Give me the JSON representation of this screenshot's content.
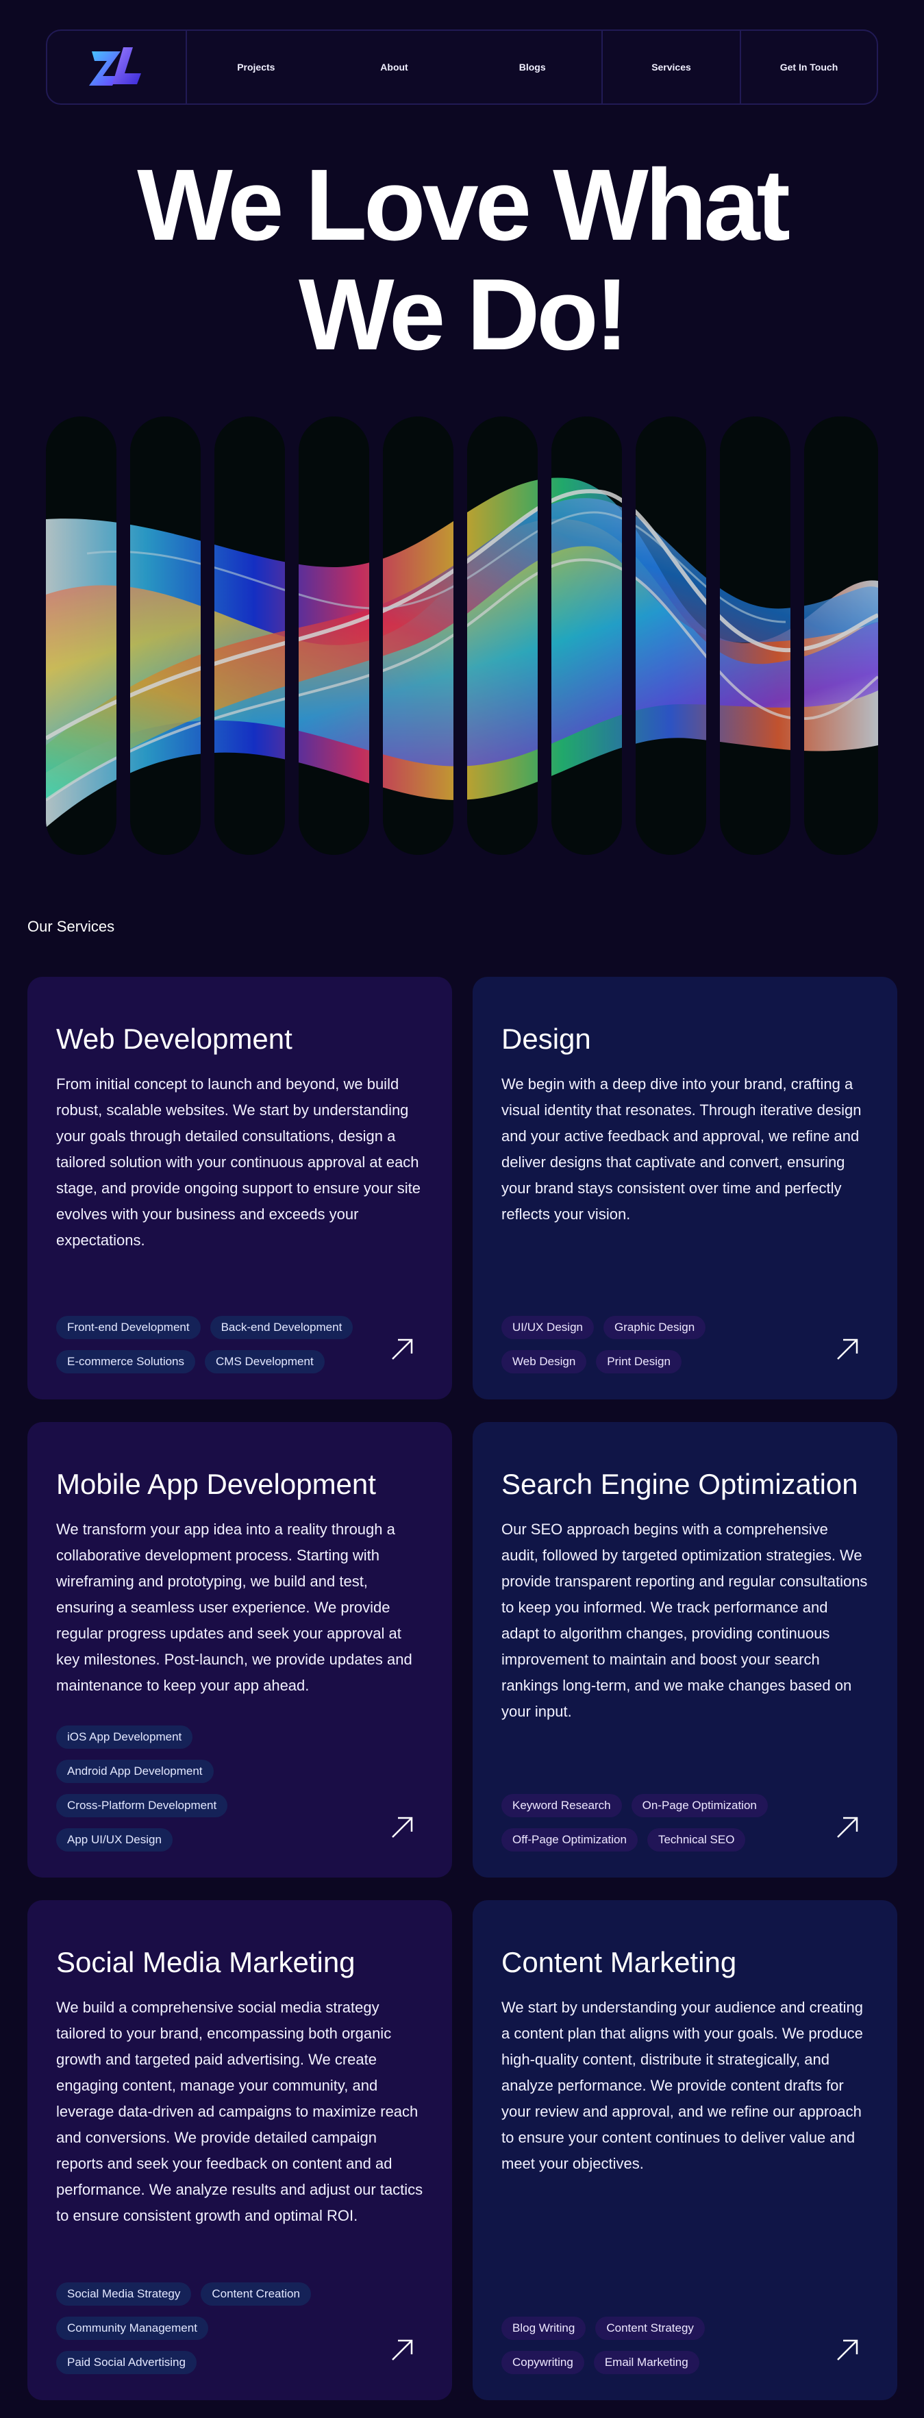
{
  "nav": {
    "logo_icon": "zl-logo-icon",
    "links": [
      "Projects",
      "About",
      "Blogs"
    ],
    "services_label": "Services",
    "contact_label": "Get In Touch"
  },
  "hero": {
    "line1": "We Love What",
    "line2": "We Do!"
  },
  "services": {
    "label": "Our Services",
    "cards": [
      {
        "title": "Web Development",
        "body": "From initial concept to launch and beyond, we build robust, scalable websites. We start by understanding your goals through detailed consultations, design a tailored solution with your continuous approval at each stage, and provide ongoing support to ensure your site evolves with your business and exceeds your expectations.",
        "tags": [
          "Front-end Development",
          "Back-end Development",
          "E-commerce Solutions",
          "CMS Development"
        ]
      },
      {
        "title": "Design",
        "body": "We begin with a deep dive into your brand, crafting a visual identity that resonates. Through iterative design and your active feedback and approval, we refine and deliver designs that captivate and convert, ensuring your brand stays consistent over time and perfectly reflects your vision.",
        "tags": [
          "UI/UX Design",
          "Graphic Design",
          "Web Design",
          "Print Design"
        ]
      },
      {
        "title": "Mobile App Development",
        "body": "We transform your app idea into a reality through a collaborative development process. Starting with wireframing and prototyping, we build and test, ensuring a seamless user experience. We provide regular progress updates and seek your approval at key milestones. Post-launch, we provide updates and maintenance to keep your app ahead.",
        "tags": [
          "iOS App Development",
          "Android App Development",
          "Cross-Platform Development",
          "App UI/UX Design"
        ]
      },
      {
        "title": "Search Engine Optimization",
        "body": "Our SEO approach begins with a comprehensive audit, followed by targeted optimization strategies. We provide transparent reporting and regular consultations to keep you informed. We track performance and adapt to algorithm changes, providing continuous improvement to maintain and boost your search rankings long-term, and we make changes based on your input.",
        "tags": [
          "Keyword Research",
          "On-Page Optimization",
          "Off-Page Optimization",
          "Technical SEO"
        ]
      },
      {
        "title": "Social Media Marketing",
        "body": "We build a comprehensive social media strategy tailored to your brand, encompassing both organic growth and targeted paid advertising. We create engaging content, manage your community, and leverage data-driven ad campaigns to maximize reach and conversions. We provide detailed campaign reports and seek your feedback on content and ad performance. We analyze results and adjust our tactics to ensure consistent growth and optimal ROI.",
        "tags": [
          "Social Media Strategy",
          "Content Creation",
          "Community Management",
          "Paid Social Advertising"
        ]
      },
      {
        "title": "Content Marketing",
        "body": "We start by understanding your audience and creating a content plan that aligns with your goals. We produce high-quality content, distribute it strategically, and analyze performance. We provide content drafts for your review and approval, and we refine our approach to ensure your content continues to deliver value and meet your objectives.",
        "tags": [
          "Blog Writing",
          "Content Strategy",
          "Copywriting",
          "Email Marketing"
        ]
      }
    ]
  }
}
